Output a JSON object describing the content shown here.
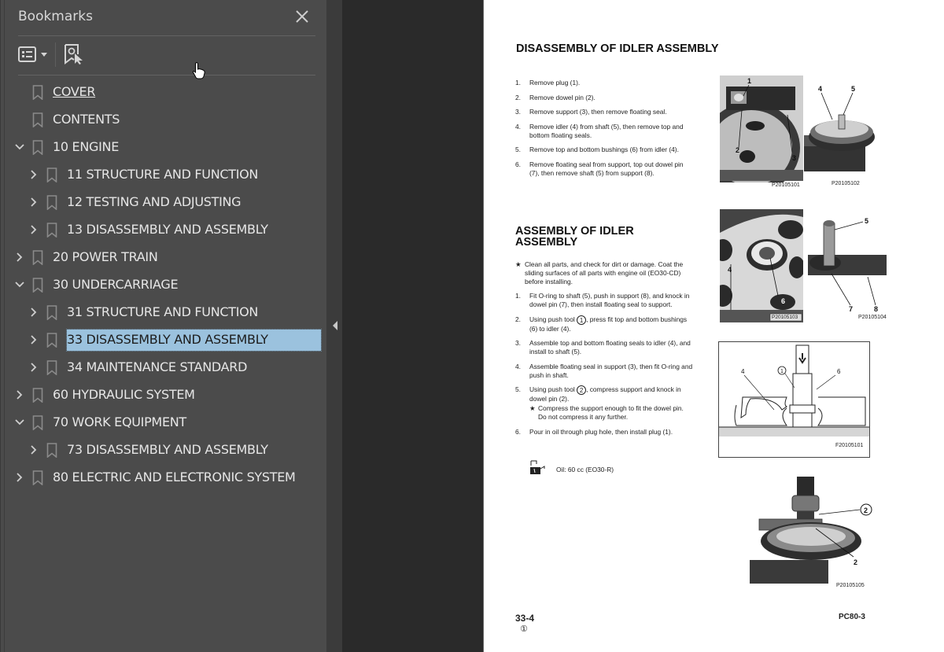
{
  "panel": {
    "title": "Bookmarks",
    "close_icon": "close-icon",
    "toolbar": {
      "options_icon": "list-options-icon",
      "options_dropdown_icon": "caret-down-icon",
      "find_bookmark_icon": "bookmark-find-icon"
    },
    "items": [
      {
        "label": "COVER",
        "level": 0,
        "expander": "none",
        "underline": true,
        "selected": false
      },
      {
        "label": "CONTENTS",
        "level": 0,
        "expander": "none",
        "underline": false,
        "selected": false
      },
      {
        "label": "10 ENGINE",
        "level": 0,
        "expander": "expanded",
        "underline": false,
        "selected": false
      },
      {
        "label": "11 STRUCTURE AND FUNCTION",
        "level": 1,
        "expander": "collapsed",
        "underline": false,
        "selected": false
      },
      {
        "label": "12 TESTING AND ADJUSTING",
        "level": 1,
        "expander": "collapsed",
        "underline": false,
        "selected": false
      },
      {
        "label": "13 DISASSEMBLY AND ASSEMBLY",
        "level": 1,
        "expander": "collapsed",
        "underline": false,
        "selected": false
      },
      {
        "label": "20 POWER TRAIN",
        "level": 0,
        "expander": "collapsed",
        "underline": false,
        "selected": false
      },
      {
        "label": "30 UNDERCARRIAGE",
        "level": 0,
        "expander": "expanded",
        "underline": false,
        "selected": false
      },
      {
        "label": "31 STRUCTURE AND FUNCTION",
        "level": 1,
        "expander": "collapsed",
        "underline": false,
        "selected": false
      },
      {
        "label": "33 DISASSEMBLY AND ASSEMBLY",
        "level": 1,
        "expander": "collapsed",
        "underline": false,
        "selected": true
      },
      {
        "label": "34 MAINTENANCE STANDARD",
        "level": 1,
        "expander": "collapsed",
        "underline": false,
        "selected": false
      },
      {
        "label": "60 HYDRAULIC SYSTEM",
        "level": 0,
        "expander": "collapsed",
        "underline": false,
        "selected": false
      },
      {
        "label": "70 WORK EQUIPMENT",
        "level": 0,
        "expander": "expanded",
        "underline": false,
        "selected": false
      },
      {
        "label": "73 DISASSEMBLY AND ASSEMBLY",
        "level": 1,
        "expander": "collapsed",
        "underline": false,
        "selected": false
      },
      {
        "label": "80 ELECTRIC AND ELECTRONIC SYSTEM",
        "level": 0,
        "expander": "collapsed",
        "underline": false,
        "selected": false
      }
    ],
    "colors": {
      "panel_bg": "#4b4b4b",
      "selected_bg": "#9bc2de",
      "viewer_bg": "#2a2a2a"
    }
  },
  "splitter": {
    "collapse_icon": "triangle-left-icon"
  },
  "page": {
    "disassembly": {
      "title": "DISASSEMBLY OF IDLER ASSEMBLY",
      "steps": [
        {
          "n": "1.",
          "text": "Remove plug (1)."
        },
        {
          "n": "2.",
          "text": "Remove dowel pin (2)."
        },
        {
          "n": "3.",
          "text": "Remove support (3), then remove floating seal."
        },
        {
          "n": "4.",
          "text": "Remove idler (4) from shaft (5), then remove top and bottom floating seals."
        },
        {
          "n": "5.",
          "text": "Remove top and bottom bushings (6) from idler (4)."
        },
        {
          "n": "6.",
          "text": "Remove floating seal from support, top out dowel pin (7), then remove shaft (5) from support (8)."
        }
      ]
    },
    "assembly": {
      "title_line1": "ASSEMBLY OF IDLER",
      "title_line2": "ASSEMBLY",
      "note": {
        "n": "★",
        "text": "Clean all parts, and check for dirt or damage. Coat the sliding surfaces of all parts with engine oil (EO30-CD) before installing."
      },
      "steps": [
        {
          "n": "1.",
          "text": "Fit O-ring to shaft (5), push in support (8), and knock in dowel pin (7), then install floating seal to support."
        },
        {
          "n": "2.",
          "pre": "Using push tool",
          "tool": "1",
          "text": ", press fit top and bottom bushings (6) to idler (4)."
        },
        {
          "n": "3.",
          "text": "Assemble top and bottom floating seals to idler (4), and install to shaft (5)."
        },
        {
          "n": "4.",
          "text": "Assemble floating seal in support (3), then fit O-ring and push in shaft."
        },
        {
          "n": "5.",
          "pre": "Using push tool",
          "tool": "2",
          "text": ", compress support and knock in dowel pin (2).",
          "subnote": {
            "n": "★",
            "text": "Compress the support enough to fit the dowel pin. Do not compress it any further."
          }
        },
        {
          "n": "6.",
          "text": "Pour in oil through plug hole, then install plug (1)."
        }
      ],
      "oil_icon": "oil-can-icon",
      "oil_text": "Oil: 60 cc (EO30-R)"
    },
    "figures": [
      {
        "caption": "P20105101",
        "callouts": [
          "1",
          "2",
          "3"
        ]
      },
      {
        "caption": "P20105102",
        "callouts": [
          "4",
          "5"
        ]
      },
      {
        "caption": "P20105103",
        "callouts": [
          "4",
          "6"
        ]
      },
      {
        "caption": "P20105104",
        "callouts": [
          "5",
          "7",
          "8"
        ]
      },
      {
        "caption": "F20105101",
        "callouts": [
          "4",
          "1",
          "6"
        ]
      },
      {
        "caption": "P20105105",
        "callouts": [
          "2",
          "2"
        ]
      }
    ],
    "footer": {
      "page": "33-4",
      "revision": "①",
      "model": "PC80-3"
    }
  }
}
